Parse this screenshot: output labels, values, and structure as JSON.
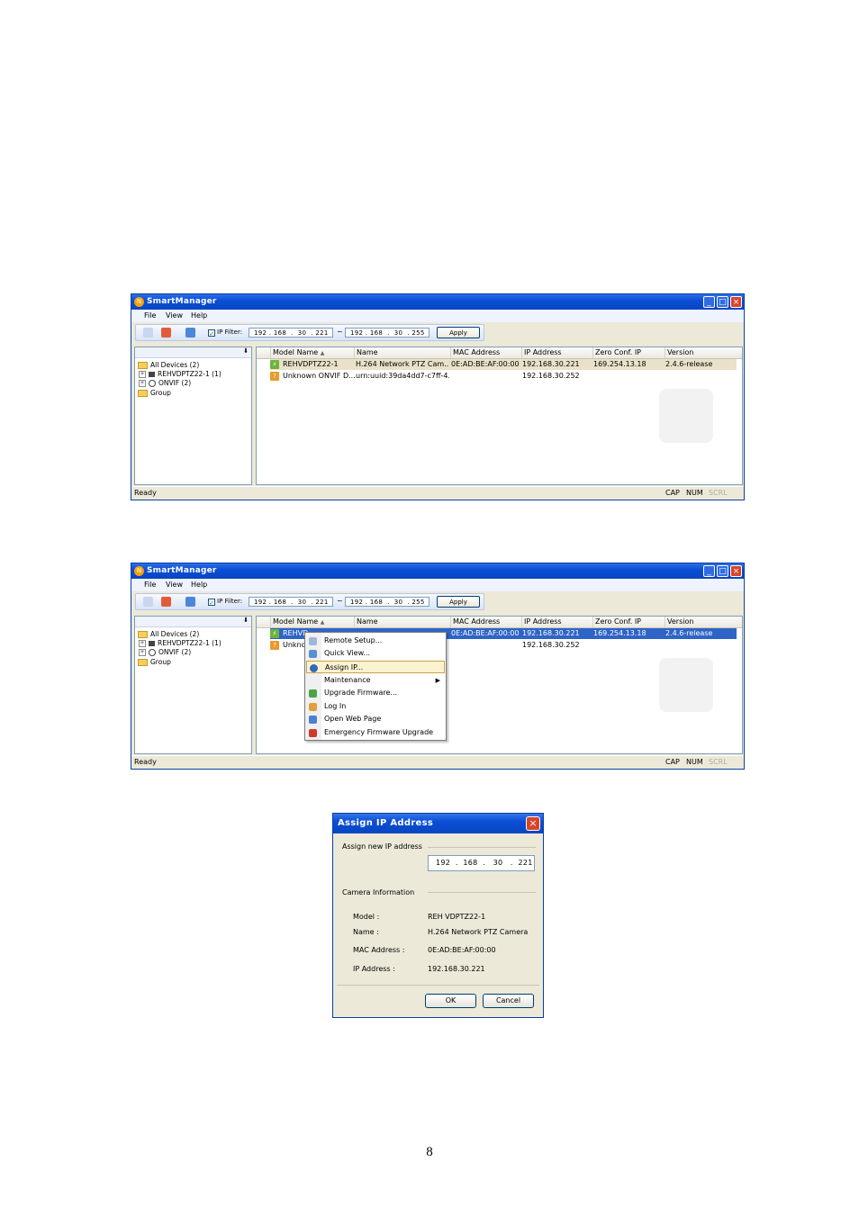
{
  "app": {
    "title": "SmartManager",
    "menu": [
      "File",
      "View",
      "Help"
    ],
    "ip_filter_label": "IP Filter:",
    "ip_from": "192 . 168  .  30  . 221",
    "ip_tilde": "~",
    "ip_to": "192 . 168  .  30  . 255",
    "apply_label": "Apply",
    "tree": {
      "pin": "⬇",
      "items": [
        "All Devices (2)",
        "REHVDPTZ22-1 (1)",
        "ONVIF (2)",
        "Group"
      ]
    },
    "columns": [
      "Model Name",
      "Name",
      "MAC Address",
      "IP Address",
      "Zero Conf. IP",
      "Version"
    ],
    "rows": [
      {
        "model": "REHVDPTZ22-1",
        "name": "H.264 Network PTZ Cam...",
        "mac": "0E:AD:BE:AF:00:00",
        "ip": "192.168.30.221",
        "zeroconf": "169.254.13.18",
        "version": "2.4.6-release"
      },
      {
        "model": "Unknown ONVIF D...",
        "name": "urn:uuid:39da4dd7-c7ff-4...",
        "mac": "",
        "ip": "192.168.30.252",
        "zeroconf": "",
        "version": ""
      }
    ],
    "status": {
      "ready": "Ready",
      "cap": "CAP",
      "num": "NUM",
      "scrl": "SCRL"
    }
  },
  "context_menu": {
    "row1_model": "REHVD",
    "row2_model": "Unkno",
    "items": [
      "Remote Setup...",
      "Quick View...",
      "Assign IP...",
      "Maintenance",
      "Upgrade Firmware...",
      "Log In",
      "Open Web Page",
      "Emergency Firmware Upgrade"
    ],
    "highlighted": "Assign IP..."
  },
  "dialog": {
    "title": "Assign IP Address",
    "assign_label": "Assign new IP address",
    "ip_value": "192  .  168  .   30   .  221",
    "camera_info_label": "Camera Information",
    "fields": [
      {
        "label": "Model :",
        "value": "REH VDPTZ22-1"
      },
      {
        "label": "Name :",
        "value": "H.264 Network PTZ Camera"
      },
      {
        "label": "MAC Address :",
        "value": "0E:AD:BE:AF:00:00"
      },
      {
        "label": "IP Address :",
        "value": "192.168.30.221"
      }
    ],
    "ok_label": "OK",
    "cancel_label": "Cancel"
  },
  "page_number": "8",
  "colors": {
    "xp_blue": "#0b4fd6",
    "selection": "#2e64c6",
    "window_bg": "#ece9d8"
  }
}
